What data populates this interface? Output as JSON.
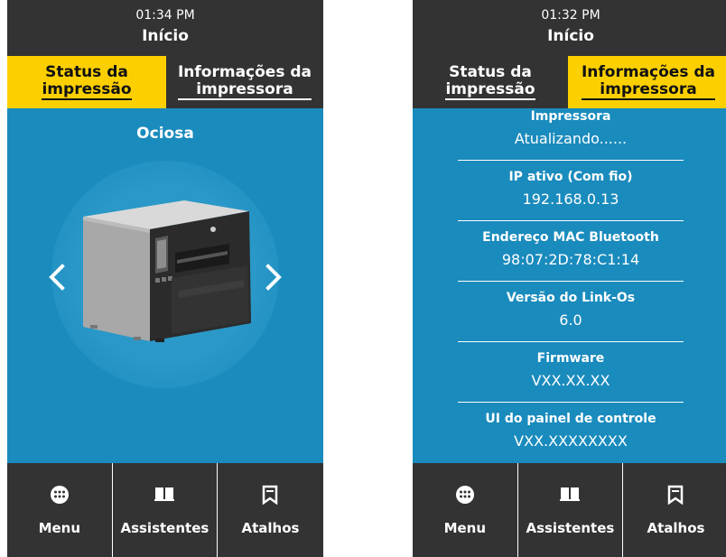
{
  "left_screen": {
    "status_bar": {
      "time": "01:34 PM",
      "title": "Início"
    },
    "tabs": [
      {
        "line1": "Status da",
        "line2": "impressão",
        "active": true
      },
      {
        "line1": "Informações da",
        "line2": "impressora",
        "active": false
      }
    ],
    "printer_state": "Ociosa",
    "carousel": {
      "prev_icon": "chevron-left-icon",
      "next_icon": "chevron-right-icon"
    },
    "bottom_nav": [
      {
        "label": "Menu",
        "icon": "menu-dots-icon"
      },
      {
        "label": "Assistentes",
        "icon": "open-book-icon"
      },
      {
        "label": "Atalhos",
        "icon": "bookmark-icon"
      }
    ]
  },
  "right_screen": {
    "status_bar": {
      "time": "01:32 PM",
      "title": "Início"
    },
    "tabs": [
      {
        "line1": "Status da",
        "line2": "impressão",
        "active": false
      },
      {
        "line1": "Informações da",
        "line2": "impressora",
        "active": true
      }
    ],
    "info": [
      {
        "label": "Impressora",
        "value": "Atualizando......"
      },
      {
        "label": "IP ativo (Com fio)",
        "value": "192.168.0.13"
      },
      {
        "label": "Endereço MAC Bluetooth",
        "value": "98:07:2D:78:C1:14"
      },
      {
        "label": "Versão do Link-Os",
        "value": "6.0"
      },
      {
        "label": "Firmware",
        "value": "VXX.XX.XX"
      },
      {
        "label": "UI do painel de controle",
        "value": "VXX.XXXXXXXX"
      }
    ],
    "bottom_nav": [
      {
        "label": "Menu",
        "icon": "menu-dots-icon"
      },
      {
        "label": "Assistentes",
        "icon": "open-book-icon"
      },
      {
        "label": "Atalhos",
        "icon": "bookmark-icon"
      }
    ]
  },
  "colors": {
    "screen_bg": "#1a8bbd",
    "bar_bg": "#333333",
    "active_tab": "#fcd000",
    "text_light": "#ffffff"
  }
}
